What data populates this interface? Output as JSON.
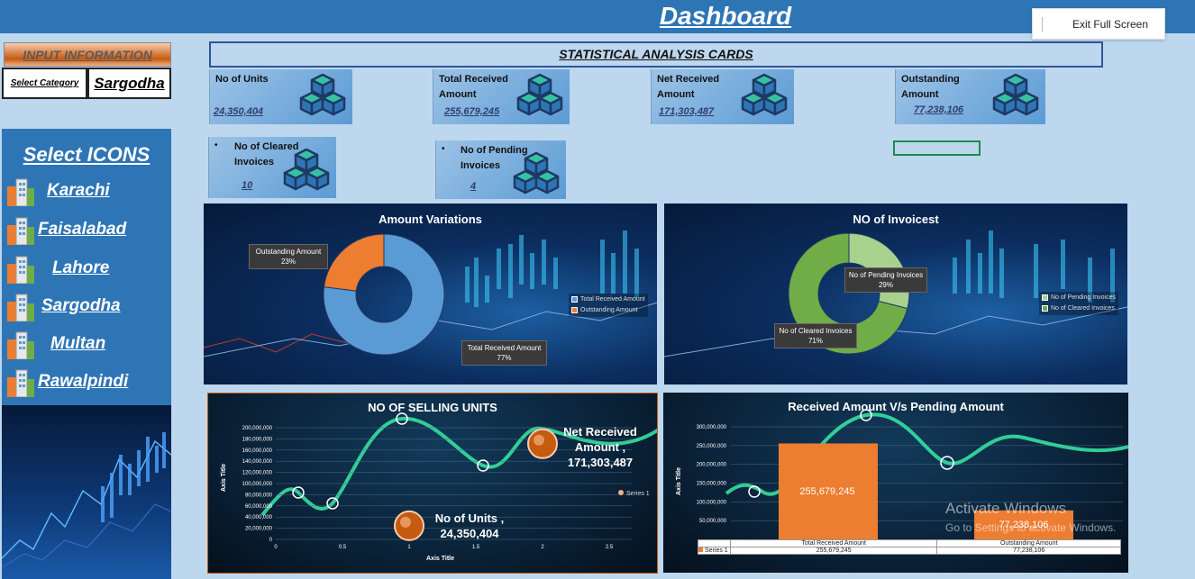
{
  "header": {
    "title": "Dashboard",
    "exit_label": "Exit Full Screen"
  },
  "left": {
    "input_info": "INPUT INFORMATION",
    "select_category": "Select Category",
    "category_value": "Sargodha",
    "icons_title": "Select ICONS",
    "cities": [
      "Karachi",
      "Faisalabad",
      "Lahore",
      "Sargodha",
      "Multan",
      "Rawalpindi"
    ]
  },
  "analysis": {
    "title": "STATISTICAL ANALYSIS CARDS",
    "cards": [
      {
        "label": "No of Units",
        "value": "24,350,404"
      },
      {
        "label": "Total Received Amount",
        "value": "255,679,245"
      },
      {
        "label": "Net Received Amount",
        "value": "171,303,487"
      },
      {
        "label": "Outstanding Amount",
        "value": "77,238,106"
      },
      {
        "label": "No of Cleared Invoices",
        "value": "10"
      },
      {
        "label": "No of Pending Invoices",
        "value": "4"
      }
    ]
  },
  "amount_variations": {
    "title": "Amount Variations",
    "slices": [
      {
        "name": "Total Received Amount",
        "pct": "77%",
        "value": 77,
        "color": "#5b9bd5"
      },
      {
        "name": "Outstanding Amount",
        "pct": "23%",
        "value": 23,
        "color": "#ed7d31"
      }
    ]
  },
  "invoices": {
    "title": "NO of Invoicest",
    "slices": [
      {
        "name": "No of Cleared Invoices",
        "pct": "71%",
        "value": 71,
        "color": "#70ad47"
      },
      {
        "name": "No of Pending Invoices",
        "pct": "29%",
        "value": 29,
        "color": "#a9d18e"
      }
    ]
  },
  "selling_units": {
    "title": "NO OF SELLING UNITS",
    "xlabel": "Axis Title",
    "ylabel": "Axis Title",
    "legend": "Series 1",
    "yticks": [
      "0",
      "20,000,000",
      "40,000,000",
      "60,000,000",
      "80,000,000",
      "100,000,000",
      "120,000,000",
      "140,000,000",
      "160,000,000",
      "180,000,000",
      "200,000,000"
    ],
    "xticks": [
      "0",
      "0.5",
      "1",
      "1.5",
      "2",
      "2.5"
    ],
    "labels": [
      {
        "name": "Net Received Amount ,",
        "value": "171,303,487"
      },
      {
        "name": "No of Units ,",
        "value": "24,350,404"
      }
    ]
  },
  "received_vs_pending": {
    "title": "Received Amount V/s Pending Amount",
    "ylabel": "Axis Title",
    "yticks": [
      "50,000,000",
      "100,000,000",
      "150,000,000",
      "200,000,000",
      "250,000,000",
      "300,000,000"
    ],
    "categories": [
      "Total Received Amount",
      "Outstanding Amount"
    ],
    "series_name": "Series 1",
    "values": [
      255679245,
      77238106
    ],
    "value_labels": [
      "255,679,245",
      "77,238,106"
    ],
    "bar_color": "#ed7d31"
  },
  "watermark": {
    "line1": "Activate Windows",
    "line2": "Go to Settings to activate Windows."
  },
  "chart_data": [
    {
      "type": "pie",
      "title": "Amount Variations",
      "categories": [
        "Total Received Amount",
        "Outstanding Amount"
      ],
      "values": [
        77,
        23
      ]
    },
    {
      "type": "pie",
      "title": "NO of Invoicest",
      "categories": [
        "No of Cleared Invoices",
        "No of Pending Invoices"
      ],
      "values": [
        71,
        29
      ]
    },
    {
      "type": "bar",
      "title": "Received Amount V/s Pending Amount",
      "categories": [
        "Total Received Amount",
        "Outstanding Amount"
      ],
      "series": [
        {
          "name": "Series 1",
          "values": [
            255679245,
            77238106
          ]
        }
      ],
      "ylabel": "Axis Title",
      "ylim": [
        0,
        300000000
      ]
    },
    {
      "type": "scatter",
      "title": "NO OF SELLING UNITS",
      "series": [
        {
          "name": "Series 1",
          "x": [
            1,
            2
          ],
          "y": [
            24350404,
            171303487
          ]
        }
      ],
      "xlabel": "Axis Title",
      "ylabel": "Axis Title",
      "xlim": [
        0,
        2.5
      ],
      "ylim": [
        0,
        200000000
      ]
    }
  ]
}
